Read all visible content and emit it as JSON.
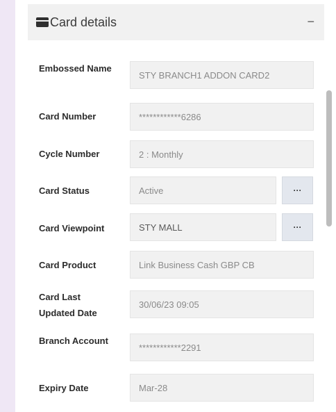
{
  "header": {
    "title": "Card details",
    "icon": "credit-card-icon",
    "collapse_symbol": "−"
  },
  "fields": [
    {
      "label": "Embossed Name",
      "value": "STY BRANCH1 ADDON CARD2"
    },
    {
      "label": "Card Number",
      "value": "************6286"
    },
    {
      "label": "Cycle Number",
      "value": "2 : Monthly"
    },
    {
      "label": "Card Status",
      "value": "Active",
      "button": "···"
    },
    {
      "label": "Card Viewpoint",
      "value": "STY MALL",
      "button": "···"
    },
    {
      "label": "Card Product",
      "value": "Link Business Cash GBP CB"
    },
    {
      "label": "Card Last Updated Date",
      "value": "30/06/23 09:05"
    },
    {
      "label": "Branch Account",
      "value": "************2291"
    },
    {
      "label": "Expiry Date",
      "value": "Mar-28"
    }
  ]
}
